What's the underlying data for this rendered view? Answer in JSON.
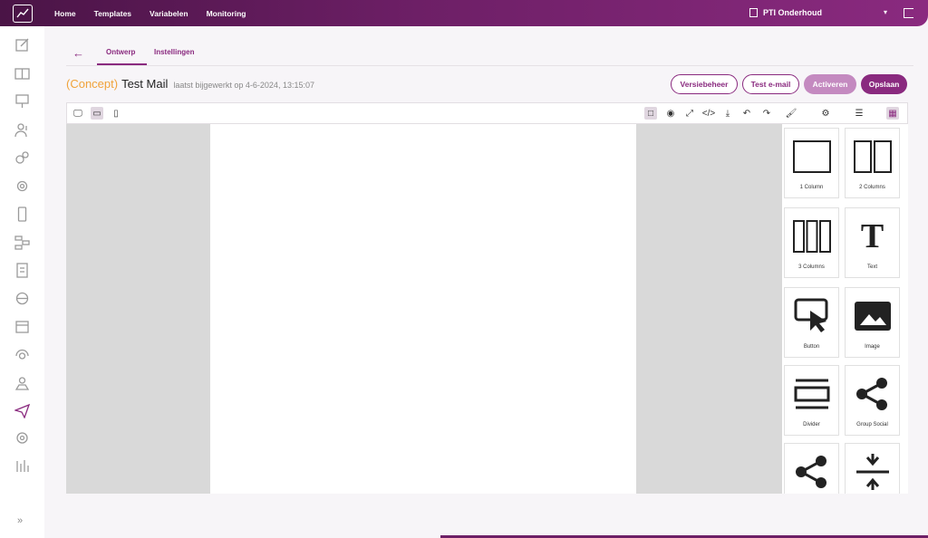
{
  "topbar": {
    "nav": [
      "Home",
      "Templates",
      "Variabelen",
      "Monitoring"
    ],
    "org": "PTI Onderhoud"
  },
  "tabs": [
    "Ontwerp",
    "Instellingen"
  ],
  "header": {
    "status": "(Concept)",
    "name": "Test Mail",
    "updated": "laatst bijgewerkt op 4-6-2024, 13:15:07",
    "buttons": {
      "versions": "Versiebeheer",
      "test": "Test e-mail",
      "activate": "Activeren",
      "save": "Opslaan"
    }
  },
  "blocks": [
    "1 Column",
    "2 Columns",
    "3 Columns",
    "Text",
    "Button",
    "Image",
    "Divider",
    "Group Social"
  ],
  "colors": {
    "brand": "#8a2a7f",
    "concept": "#f0a33a"
  }
}
